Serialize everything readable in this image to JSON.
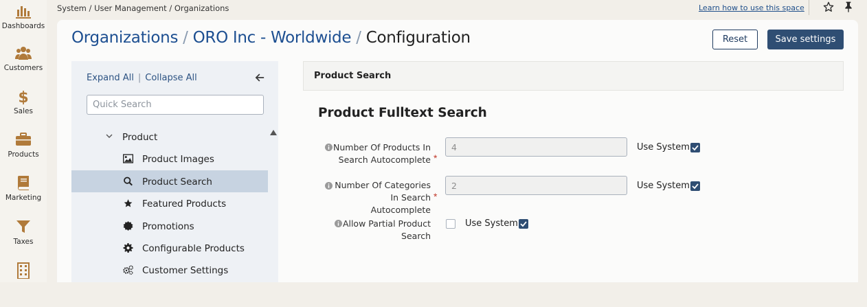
{
  "nav": {
    "items": [
      {
        "label": "Dashboards",
        "icon": "dashboard-icon"
      },
      {
        "label": "Customers",
        "icon": "customers-icon"
      },
      {
        "label": "Sales",
        "icon": "dollar-icon"
      },
      {
        "label": "Products",
        "icon": "briefcase-icon"
      },
      {
        "label": "Marketing",
        "icon": "book-icon"
      },
      {
        "label": "Taxes",
        "icon": "funnel-icon"
      },
      {
        "label": "",
        "icon": "building-icon"
      }
    ]
  },
  "topbar": {
    "breadcrumb": "System / User Management / Organizations",
    "help_link": "Learn how to use this space"
  },
  "header": {
    "title_link_1": "Organizations",
    "separator": "/",
    "title_link_2": "ORO Inc - Worldwide",
    "title_current": "Configuration",
    "reset_label": "Reset",
    "save_label": "Save settings"
  },
  "tree": {
    "expand_all": "Expand All",
    "divider": "|",
    "collapse_all": "Collapse All",
    "search_placeholder": "Quick Search",
    "parent": "Product",
    "items": [
      {
        "label": "Product Images",
        "icon": "image-icon"
      },
      {
        "label": "Product Search",
        "icon": "search-icon",
        "active": true
      },
      {
        "label": "Featured Products",
        "icon": "star-icon"
      },
      {
        "label": "Promotions",
        "icon": "badge-icon"
      },
      {
        "label": "Configurable Products",
        "icon": "gear-icon"
      },
      {
        "label": "Customer Settings",
        "icon": "gears-icon"
      }
    ]
  },
  "section": {
    "header": "Product Search",
    "group_title": "Product Fulltext Search",
    "fields": [
      {
        "label_line1": "Number Of Products In",
        "label_line2": "Search Autocomplete",
        "value": "4",
        "required": "*",
        "use_system": "Use System",
        "use_system_checked": true
      },
      {
        "label_line1": "Number Of Categories",
        "label_line2": "In Search Autocomplete",
        "value": "2",
        "required": "*",
        "use_system": "Use System",
        "use_system_checked": true
      },
      {
        "label_line1": "Allow Partial Product",
        "label_line2": "Search",
        "checked": false,
        "use_system": "Use System",
        "use_system_checked": true
      }
    ]
  },
  "colors": {
    "accent": "#2f4e73",
    "link": "#1d4f91",
    "nav_icon": "#b07a3a",
    "active_row": "#c7d3e1"
  }
}
